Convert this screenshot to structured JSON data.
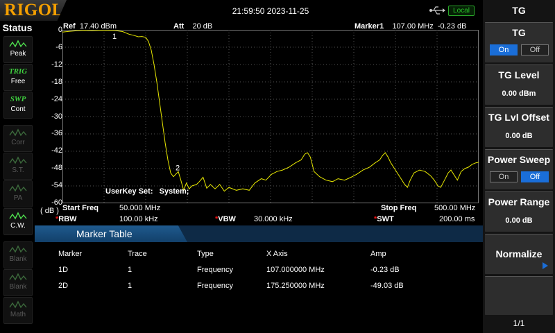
{
  "header": {
    "logo": "RIGOL",
    "datetime": "21:59:50 2023-11-25",
    "local_badge": "Local"
  },
  "status": {
    "title": "Status",
    "items": [
      {
        "label": "Peak",
        "state": "active"
      },
      {
        "top": "TRIG",
        "label": "Free",
        "state": "active"
      },
      {
        "top": "SWP",
        "label": "Cont",
        "state": "active"
      },
      {
        "label": "Corr",
        "state": "dim"
      },
      {
        "label": "S.T.",
        "state": "dim"
      },
      {
        "label": "PA",
        "state": "dim"
      },
      {
        "label": "C.W.",
        "state": "active"
      },
      {
        "label": "Blank",
        "state": "dim"
      },
      {
        "label": "Blank",
        "state": "dim"
      },
      {
        "label": "Math",
        "state": "dim"
      }
    ]
  },
  "graph_header": {
    "ref_label": "Ref",
    "ref_value": "17.40 dBm",
    "att_label": "Att",
    "att_value": "20 dB",
    "marker_label": "Marker1",
    "marker_freq": "107.00 MHz",
    "marker_amp": "-0.23 dB"
  },
  "y_axis": {
    "unit": "( dB )",
    "ticks": [
      "0",
      "-6",
      "-12",
      "-18",
      "-24",
      "-30",
      "-36",
      "-42",
      "-48",
      "-54",
      "-60"
    ]
  },
  "overlay": {
    "userkey_label": "UserKey Set:",
    "userkey_value": "System;"
  },
  "markers": [
    {
      "id": "1",
      "freq_mhz": 107.0,
      "amp_db": -0.23
    },
    {
      "id": "2",
      "freq_mhz": 175.25,
      "amp_db": -49.03
    }
  ],
  "chart_data": {
    "type": "line",
    "xlim": [
      50,
      500
    ],
    "ylim": [
      -60,
      0
    ],
    "x_unit": "MHz",
    "y_unit": "dB",
    "grid": true,
    "series": [
      {
        "color": "#e8e800",
        "points": [
          [
            50,
            -0.8
          ],
          [
            58,
            -0.5
          ],
          [
            66,
            -0.3
          ],
          [
            74,
            -0.2
          ],
          [
            82,
            -0.3
          ],
          [
            90,
            -0.2
          ],
          [
            98,
            -0.2
          ],
          [
            107,
            -0.23
          ],
          [
            115,
            -0.6
          ],
          [
            122,
            -1.5
          ],
          [
            128,
            -2.0
          ],
          [
            132,
            -2.4
          ],
          [
            136,
            -2.3
          ],
          [
            140,
            -2.6
          ],
          [
            143,
            -4.0
          ],
          [
            146,
            -7.0
          ],
          [
            149,
            -12.0
          ],
          [
            152,
            -18.0
          ],
          [
            155,
            -25.0
          ],
          [
            158,
            -32.0
          ],
          [
            161,
            -39.0
          ],
          [
            164,
            -45.0
          ],
          [
            167,
            -49.5
          ],
          [
            170,
            -50.8
          ],
          [
            175.25,
            -49.03
          ],
          [
            178,
            -52.0
          ],
          [
            181,
            -55.5
          ],
          [
            184,
            -53.0
          ],
          [
            187,
            -55.0
          ],
          [
            190,
            -54.0
          ],
          [
            195,
            -53.5
          ],
          [
            198,
            -52.5
          ],
          [
            202,
            -51.0
          ],
          [
            206,
            -54.8
          ],
          [
            210,
            -53.5
          ],
          [
            215,
            -55.0
          ],
          [
            220,
            -53.5
          ],
          [
            225,
            -55.8
          ],
          [
            230,
            -54.5
          ],
          [
            238,
            -55.5
          ],
          [
            245,
            -55.0
          ],
          [
            252,
            -55.5
          ],
          [
            258,
            -53.0
          ],
          [
            265,
            -51.5
          ],
          [
            270,
            -52.0
          ],
          [
            276,
            -50.0
          ],
          [
            282,
            -49.0
          ],
          [
            288,
            -48.5
          ],
          [
            295,
            -47.5
          ],
          [
            302,
            -46.0
          ],
          [
            308,
            -45.0
          ],
          [
            312,
            -43.0
          ],
          [
            315,
            -42.5
          ],
          [
            318,
            -44.0
          ],
          [
            322,
            -49.0
          ],
          [
            328,
            -50.8
          ],
          [
            335,
            -52.0
          ],
          [
            342,
            -52.5
          ],
          [
            348,
            -51.5
          ],
          [
            355,
            -52.0
          ],
          [
            362,
            -51.0
          ],
          [
            368,
            -50.0
          ],
          [
            375,
            -48.5
          ],
          [
            382,
            -47.5
          ],
          [
            388,
            -46.0
          ],
          [
            393,
            -45.0
          ],
          [
            396,
            -43.5
          ],
          [
            399,
            -42.5
          ],
          [
            402,
            -44.0
          ],
          [
            405,
            -46.0
          ],
          [
            410,
            -48.5
          ],
          [
            415,
            -51.0
          ],
          [
            420,
            -53.5
          ],
          [
            423,
            -54.5
          ],
          [
            426,
            -52.0
          ],
          [
            430,
            -49.5
          ],
          [
            436,
            -48.5
          ],
          [
            442,
            -49.0
          ],
          [
            448,
            -50.5
          ],
          [
            452,
            -52.0
          ],
          [
            456,
            -54.0
          ],
          [
            459,
            -54.5
          ],
          [
            463,
            -52.0
          ],
          [
            467,
            -49.5
          ],
          [
            470,
            -48.5
          ],
          [
            473,
            -50.0
          ],
          [
            477,
            -52.0
          ],
          [
            481,
            -49.0
          ],
          [
            485,
            -48.0
          ],
          [
            489,
            -47.5
          ],
          [
            493,
            -46.5
          ],
          [
            497,
            -46.0
          ],
          [
            500,
            -45.8
          ]
        ]
      }
    ]
  },
  "freq_info": {
    "start_label": "Start Freq",
    "start_value": "50.000 MHz",
    "stop_label": "Stop Freq",
    "stop_value": "500.00 MHz",
    "rbw_label": "RBW",
    "rbw_value": "100.00 kHz",
    "vbw_label": "VBW",
    "vbw_value": "30.000 kHz",
    "swt_label": "SWT",
    "swt_value": "200.00 ms"
  },
  "marker_table": {
    "title": "Marker Table",
    "headers": [
      "Marker",
      "Trace",
      "Type",
      "X Axis",
      "Amp"
    ],
    "rows": [
      [
        "1D",
        "1",
        "Frequency",
        "107.000000 MHz",
        "-0.23 dB"
      ],
      [
        "2D",
        "1",
        "Frequency",
        "175.250000 MHz",
        "-49.03 dB"
      ]
    ]
  },
  "softkeys": {
    "title": "TG",
    "tg": {
      "label": "TG",
      "on": "On",
      "off": "Off",
      "selected": "On"
    },
    "tg_level": {
      "label": "TG Level",
      "value": "0.00 dBm"
    },
    "tg_offset": {
      "label": "TG Lvl Offset",
      "value": "0.00 dB"
    },
    "power_sweep": {
      "label": "Power Sweep",
      "on": "On",
      "off": "Off",
      "selected": "Off"
    },
    "power_range": {
      "label": "Power Range",
      "value": "0.00 dB"
    },
    "normalize": {
      "label": "Normalize"
    },
    "page": "1/1"
  },
  "colors": {
    "trace": "#e8e800",
    "accent": "#1a6ed8",
    "logo": "#f5a000",
    "table_header": "#12406a"
  }
}
